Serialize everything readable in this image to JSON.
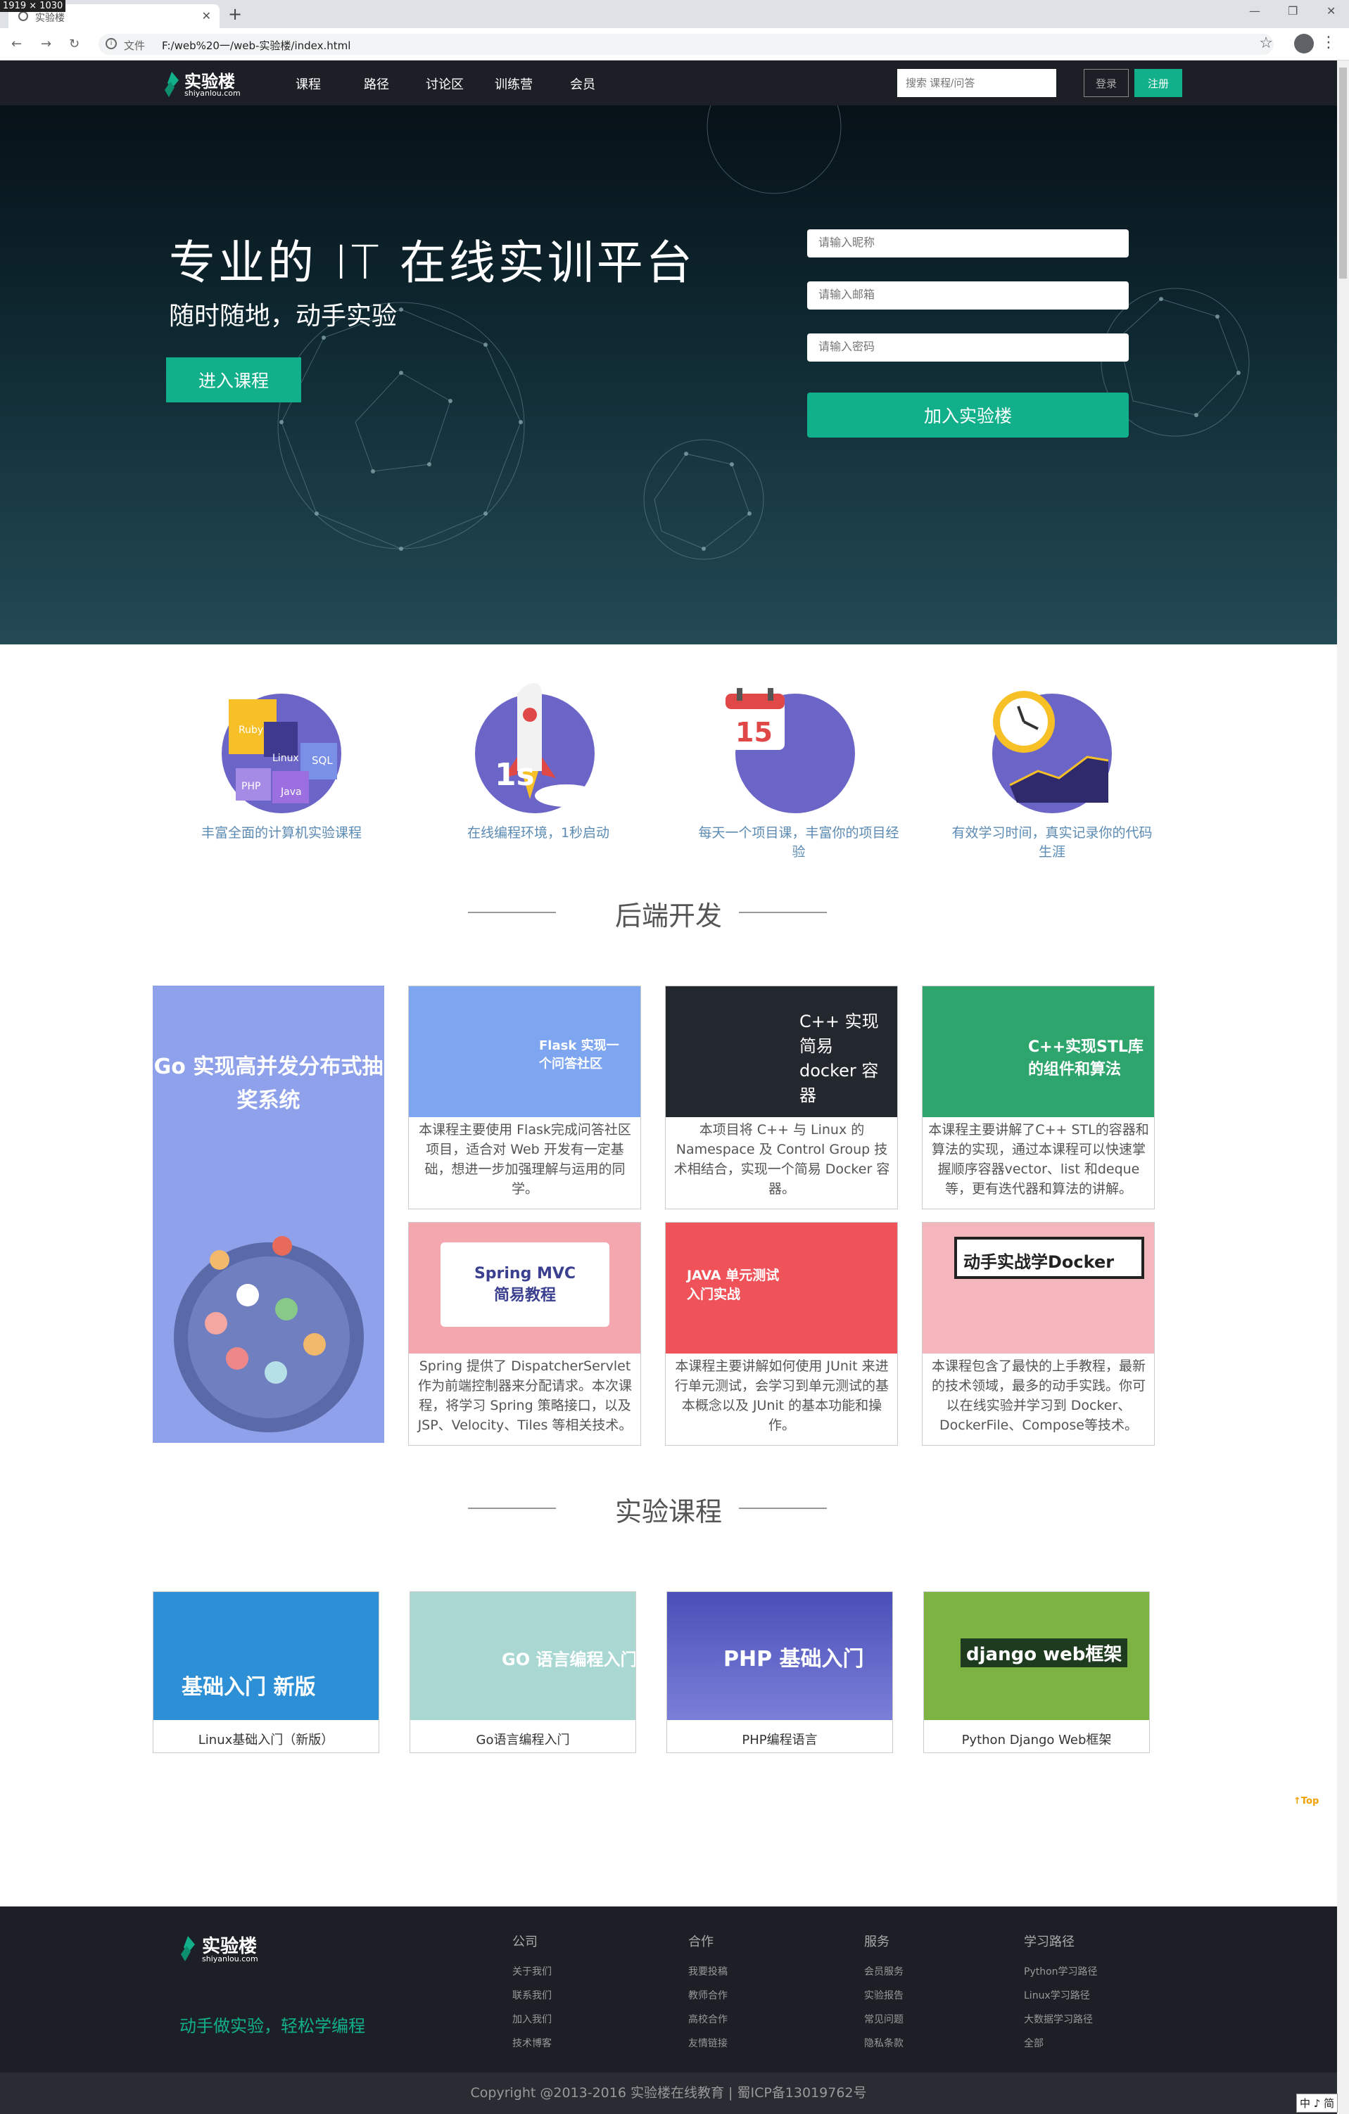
{
  "browser": {
    "dims_label": "1919 × 1030",
    "tab_title": "实验楼",
    "new_tab": "+",
    "scheme": "文件",
    "url": "F:/web%20一/web-实验楼/index.html"
  },
  "header": {
    "logo_text": "实验楼",
    "logo_sub": "shiyanlou.com",
    "nav": [
      "课程",
      "路径",
      "讨论区",
      "训练营",
      "会员"
    ],
    "search_placeholder": "搜索 课程/问答",
    "login": "登录",
    "register": "注册"
  },
  "hero": {
    "title": "专业的 IT 在线实训平台",
    "subtitle": "随时随地，动手实验",
    "cta": "进入课程",
    "nick_placeholder": "请输入昵称",
    "email_placeholder": "请输入邮箱",
    "pwd_placeholder": "请输入密码",
    "join": "加入实验楼"
  },
  "features": [
    {
      "caption": "丰富全面的计算机实验课程",
      "icon": "languages-icon",
      "labels": [
        "Ruby",
        "Linux",
        "SQL",
        "PHP",
        "Java"
      ]
    },
    {
      "caption": "在线编程环境，1秒启动",
      "icon": "rocket-icon",
      "labels": [
        "1s"
      ]
    },
    {
      "caption": "每天一个项目课，丰富你的项目经验",
      "icon": "calendar-icon",
      "labels": [
        "15"
      ]
    },
    {
      "caption": "有效学习时间，真实记录你的代码生涯",
      "icon": "clock-icon",
      "labels": []
    }
  ],
  "backend": {
    "title": "后端开发",
    "featured_title": "Go 实现高并发分布式抽奖系统",
    "cards": [
      {
        "thumb_label": "Flask 实现一个问答社区",
        "thumb_color": "#7ea6f0",
        "desc": "本课程主要使用 Flask完成问答社区项目，适合对 Web 开发有一定基础，想进一步加强理解与运用的同学。"
      },
      {
        "thumb_label": "C++ 实现简易 docker 容器",
        "thumb_color": "#23272e",
        "desc": "本项目将 C++ 与 Linux 的 Namespace 及 Control Group 技术相结合，实现一个简易 Docker 容器。"
      },
      {
        "thumb_label": "C++实现STL库的组件和算法",
        "thumb_color": "#2fa56e",
        "desc": "本课程主要讲解了C++ STL的容器和算法的实现，通过本课程可以快速掌握顺序容器vector、list 和deque等，更有迭代器和算法的讲解。"
      },
      {
        "thumb_label": "Spring MVC 简易教程",
        "thumb_color": "#f5a7b0",
        "desc": "Spring 提供了 DispatcherServlet 作为前端控制器来分配请求。本次课程，将学习 Spring 策略接口，以及 JSP、Velocity、Tiles 等相关技术。"
      },
      {
        "thumb_label": "JAVA 单元测试入门实战",
        "thumb_color": "#ef5258",
        "desc": "本课程主要讲解如何使用 JUnit 来进行单元测试，会学习到单元测试的基本概念以及 JUnit 的基本功能和操作。"
      },
      {
        "thumb_label": "动手实战学Docker",
        "thumb_color": "#f4b6bc",
        "desc": "本课程包含了最快的上手教程，最新的技术领域，最多的动手实践。你可以在线实验并学习到 Docker、DockerFile、Compose等技术。"
      }
    ]
  },
  "experiments": {
    "title": "实验课程",
    "courses": [
      {
        "name": "Linux基础入门（新版）",
        "thumb_label": "基础入门 新版",
        "thumb_color": "#2d8fd5"
      },
      {
        "name": "Go语言编程入门",
        "thumb_label": "GO 语言编程入门",
        "thumb_color": "#a9d8d3"
      },
      {
        "name": "PHP编程语言",
        "thumb_label": "PHP 基础入门",
        "thumb_color": "#5a60c8"
      },
      {
        "name": "Python Django Web框架",
        "thumb_label": "django web框架",
        "thumb_color": "#7cb342"
      }
    ]
  },
  "footer": {
    "logo_text": "实验楼",
    "logo_sub": "shiyanlou.com",
    "slogan": "动手做实验，轻松学编程",
    "columns": [
      {
        "heading": "公司",
        "links": [
          "关于我们",
          "联系我们",
          "加入我们",
          "技术博客"
        ]
      },
      {
        "heading": "合作",
        "links": [
          "我要投稿",
          "教师合作",
          "高校合作",
          "友情链接"
        ]
      },
      {
        "heading": "服务",
        "links": [
          "会员服务",
          "实验报告",
          "常见问题",
          "隐私条款"
        ]
      },
      {
        "heading": "学习路径",
        "links": [
          "Python学习路径",
          "Linux学习路径",
          "大数据学习路径",
          "全部"
        ]
      }
    ],
    "copyright": "Copyright @2013-2016 实验楼在线教育 | 蜀ICP备13019762号"
  },
  "misc": {
    "top": "Top",
    "ime": "中 ♪ 简"
  },
  "colors": {
    "accent": "#11b08a",
    "header_bg": "#1d1f26",
    "feature_circle": "#6b65c7"
  }
}
